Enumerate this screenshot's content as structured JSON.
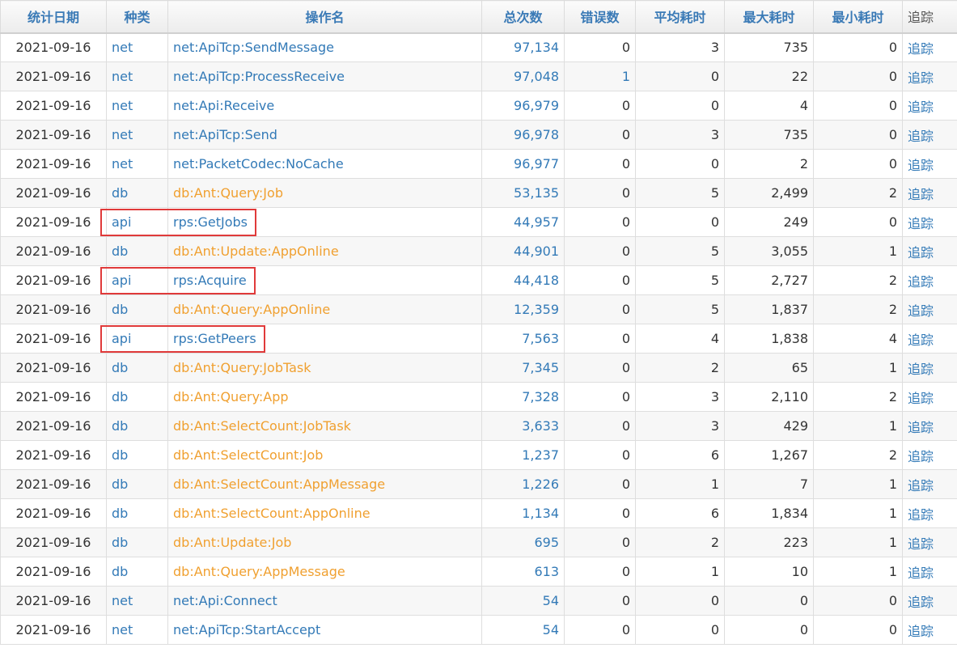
{
  "headers": {
    "date": "统计日期",
    "type": "种类",
    "name": "操作名",
    "total": "总次数",
    "errors": "错误数",
    "avg": "平均耗时",
    "max": "最大耗时",
    "min": "最小耗时",
    "trace": "追踪"
  },
  "rows": [
    {
      "date": "2021-09-16",
      "type": "net",
      "name": "net:ApiTcp:SendMessage",
      "total": "97,134",
      "errors": "0",
      "avg": "3",
      "max": "735",
      "min": "0",
      "trace": "追踪"
    },
    {
      "date": "2021-09-16",
      "type": "net",
      "name": "net:ApiTcp:ProcessReceive",
      "total": "97,048",
      "errors": "1",
      "avg": "0",
      "max": "22",
      "min": "0",
      "trace": "追踪"
    },
    {
      "date": "2021-09-16",
      "type": "net",
      "name": "net:Api:Receive",
      "total": "96,979",
      "errors": "0",
      "avg": "0",
      "max": "4",
      "min": "0",
      "trace": "追踪"
    },
    {
      "date": "2021-09-16",
      "type": "net",
      "name": "net:ApiTcp:Send",
      "total": "96,978",
      "errors": "0",
      "avg": "3",
      "max": "735",
      "min": "0",
      "trace": "追踪"
    },
    {
      "date": "2021-09-16",
      "type": "net",
      "name": "net:PacketCodec:NoCache",
      "total": "96,977",
      "errors": "0",
      "avg": "0",
      "max": "2",
      "min": "0",
      "trace": "追踪"
    },
    {
      "date": "2021-09-16",
      "type": "db",
      "name": "db:Ant:Query:Job",
      "total": "53,135",
      "errors": "0",
      "avg": "5",
      "max": "2,499",
      "min": "2",
      "trace": "追踪"
    },
    {
      "date": "2021-09-16",
      "type": "api",
      "name": "rps:GetJobs",
      "total": "44,957",
      "errors": "0",
      "avg": "0",
      "max": "249",
      "min": "0",
      "trace": "追踪"
    },
    {
      "date": "2021-09-16",
      "type": "db",
      "name": "db:Ant:Update:AppOnline",
      "total": "44,901",
      "errors": "0",
      "avg": "5",
      "max": "3,055",
      "min": "1",
      "trace": "追踪"
    },
    {
      "date": "2021-09-16",
      "type": "api",
      "name": "rps:Acquire",
      "total": "44,418",
      "errors": "0",
      "avg": "5",
      "max": "2,727",
      "min": "2",
      "trace": "追踪"
    },
    {
      "date": "2021-09-16",
      "type": "db",
      "name": "db:Ant:Query:AppOnline",
      "total": "12,359",
      "errors": "0",
      "avg": "5",
      "max": "1,837",
      "min": "2",
      "trace": "追踪"
    },
    {
      "date": "2021-09-16",
      "type": "api",
      "name": "rps:GetPeers",
      "total": "7,563",
      "errors": "0",
      "avg": "4",
      "max": "1,838",
      "min": "4",
      "trace": "追踪"
    },
    {
      "date": "2021-09-16",
      "type": "db",
      "name": "db:Ant:Query:JobTask",
      "total": "7,345",
      "errors": "0",
      "avg": "2",
      "max": "65",
      "min": "1",
      "trace": "追踪"
    },
    {
      "date": "2021-09-16",
      "type": "db",
      "name": "db:Ant:Query:App",
      "total": "7,328",
      "errors": "0",
      "avg": "3",
      "max": "2,110",
      "min": "2",
      "trace": "追踪"
    },
    {
      "date": "2021-09-16",
      "type": "db",
      "name": "db:Ant:SelectCount:JobTask",
      "total": "3,633",
      "errors": "0",
      "avg": "3",
      "max": "429",
      "min": "1",
      "trace": "追踪"
    },
    {
      "date": "2021-09-16",
      "type": "db",
      "name": "db:Ant:SelectCount:Job",
      "total": "1,237",
      "errors": "0",
      "avg": "6",
      "max": "1,267",
      "min": "2",
      "trace": "追踪"
    },
    {
      "date": "2021-09-16",
      "type": "db",
      "name": "db:Ant:SelectCount:AppMessage",
      "total": "1,226",
      "errors": "0",
      "avg": "1",
      "max": "7",
      "min": "1",
      "trace": "追踪"
    },
    {
      "date": "2021-09-16",
      "type": "db",
      "name": "db:Ant:SelectCount:AppOnline",
      "total": "1,134",
      "errors": "0",
      "avg": "6",
      "max": "1,834",
      "min": "1",
      "trace": "追踪"
    },
    {
      "date": "2021-09-16",
      "type": "db",
      "name": "db:Ant:Update:Job",
      "total": "695",
      "errors": "0",
      "avg": "2",
      "max": "223",
      "min": "1",
      "trace": "追踪"
    },
    {
      "date": "2021-09-16",
      "type": "db",
      "name": "db:Ant:Query:AppMessage",
      "total": "613",
      "errors": "0",
      "avg": "1",
      "max": "10",
      "min": "1",
      "trace": "追踪"
    },
    {
      "date": "2021-09-16",
      "type": "net",
      "name": "net:Api:Connect",
      "total": "54",
      "errors": "0",
      "avg": "0",
      "max": "0",
      "min": "0",
      "trace": "追踪"
    },
    {
      "date": "2021-09-16",
      "type": "net",
      "name": "net:ApiTcp:StartAccept",
      "total": "54",
      "errors": "0",
      "avg": "0",
      "max": "0",
      "min": "0",
      "trace": "追踪"
    }
  ],
  "highlighted_rows": [
    6,
    8,
    10
  ],
  "colors": {
    "link": "#337ab7",
    "db_link": "#f0a030",
    "highlight": "#e03a3a"
  }
}
